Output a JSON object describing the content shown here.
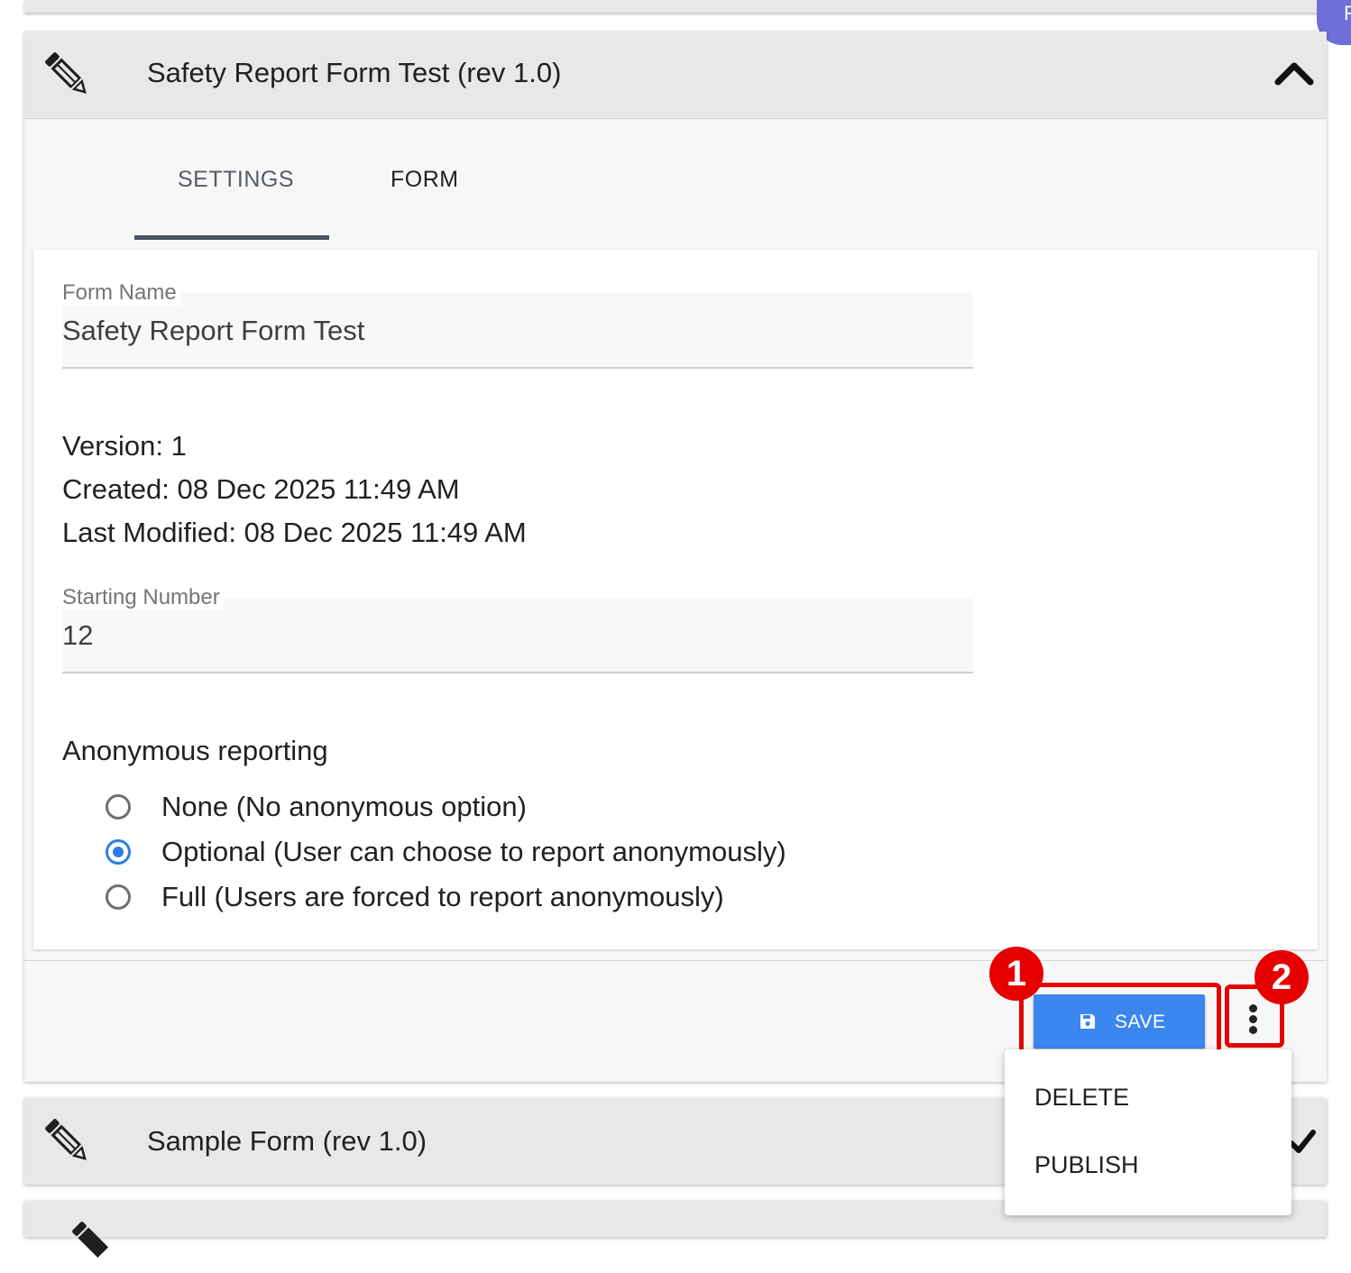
{
  "avatar": {
    "initial": "F"
  },
  "panels": [
    {
      "title": "Safety Report Form Test (rev 1.0)",
      "icon": "pencil-icon",
      "expanded_icon": "chevron-up-icon",
      "tabs": [
        {
          "label": "SETTINGS",
          "active": true
        },
        {
          "label": "FORM",
          "active": false
        }
      ],
      "form_name": {
        "label": "Form Name",
        "value": "Safety Report Form Test"
      },
      "meta": {
        "version": "Version: 1",
        "created": "Created: 08 Dec 2025 11:49 AM",
        "modified": "Last Modified: 08 Dec 2025 11:49 AM"
      },
      "starting_number": {
        "label": "Starting Number",
        "value": "12"
      },
      "anonymous": {
        "label": "Anonymous reporting",
        "options": [
          {
            "label": "None (No anonymous option)",
            "checked": false
          },
          {
            "label": "Optional (User can choose to report anonymously)",
            "checked": true
          },
          {
            "label": "Full (Users are forced to report anonymously)",
            "checked": false
          }
        ]
      },
      "actions": {
        "save_label": "SAVE",
        "more_icon": "more-vertical-icon"
      }
    },
    {
      "title": "Sample Form (rev 1.0)",
      "icon": "pencil-icon",
      "status_icon": "check-icon"
    }
  ],
  "menu": {
    "items": [
      {
        "label": "DELETE"
      },
      {
        "label": "PUBLISH"
      }
    ]
  },
  "annotations": [
    {
      "number": "1",
      "target": "save-button"
    },
    {
      "number": "2",
      "target": "more-options-button"
    }
  ],
  "colors": {
    "primary": "#3c86f0",
    "radio_checked": "#2f7de1",
    "annotation": "#e60000",
    "avatar": "#6f6fd8"
  }
}
